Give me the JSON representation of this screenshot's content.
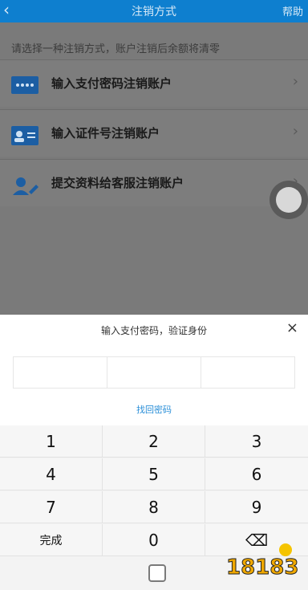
{
  "header": {
    "back_icon": "‹",
    "title": "注销方式",
    "help": "帮助"
  },
  "notice": "请选择一种注销方式，账户注销后余额将清零",
  "options": [
    {
      "label": "输入支付密码注销账户",
      "icon": "card-icon"
    },
    {
      "label": "输入证件号注销账户",
      "icon": "id-card-icon"
    },
    {
      "label": "提交资料给客服注销账户",
      "icon": "person-edit-icon"
    }
  ],
  "sheet": {
    "title": "输入支付密码，验证身份",
    "close": "×",
    "recover": "找回密码"
  },
  "keypad": {
    "k1": "1",
    "k2": "2",
    "k3": "3",
    "k4": "4",
    "k5": "5",
    "k6": "6",
    "k7": "7",
    "k8": "8",
    "k9": "9",
    "done": "完成",
    "k0": "0",
    "delete": "⌫"
  },
  "watermark": "18183"
}
